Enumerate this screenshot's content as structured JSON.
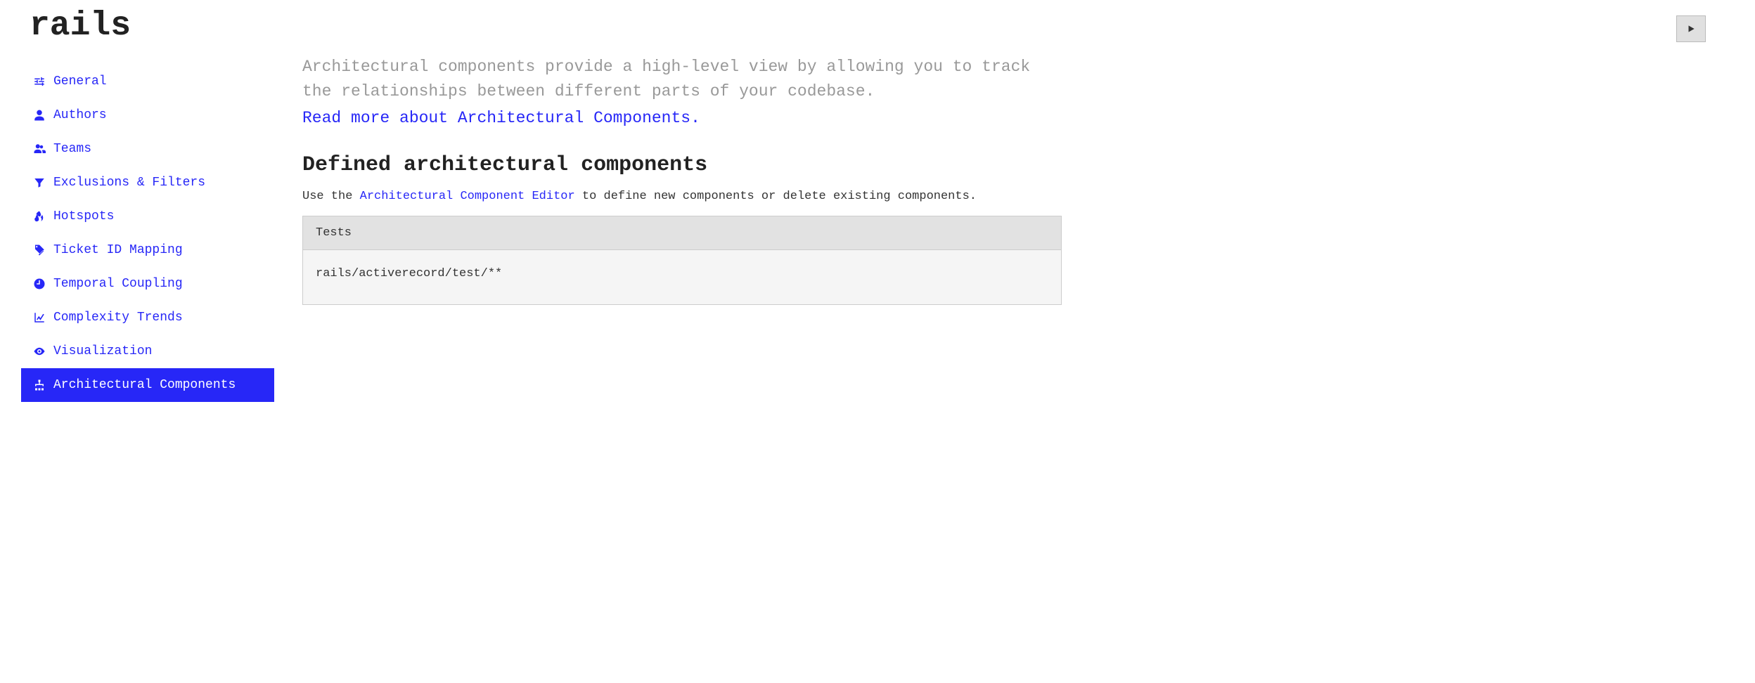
{
  "header": {
    "title": "rails"
  },
  "sidebar": {
    "items": [
      {
        "label": "General",
        "icon": "sliders-icon"
      },
      {
        "label": "Authors",
        "icon": "user-icon"
      },
      {
        "label": "Teams",
        "icon": "users-icon"
      },
      {
        "label": "Exclusions & Filters",
        "icon": "filter-icon"
      },
      {
        "label": "Hotspots",
        "icon": "fire-icon"
      },
      {
        "label": "Ticket ID Mapping",
        "icon": "tags-icon"
      },
      {
        "label": "Temporal Coupling",
        "icon": "clock-icon"
      },
      {
        "label": "Complexity Trends",
        "icon": "chart-line-icon"
      },
      {
        "label": "Visualization",
        "icon": "eye-icon"
      },
      {
        "label": "Architectural Components",
        "icon": "sitemap-icon",
        "active": true
      }
    ]
  },
  "main": {
    "intro_text": "Architectural components provide a high-level view by allowing you to track the relationships between different parts of your codebase.",
    "intro_link": "Read more about Architectural Components.",
    "section_heading": "Defined architectural components",
    "sub_prefix": "Use the ",
    "sub_link": "Architectural Component Editor",
    "sub_suffix": " to define new components or delete existing components.",
    "component": {
      "name": "Tests",
      "pattern": "rails/activerecord/test/**"
    }
  }
}
